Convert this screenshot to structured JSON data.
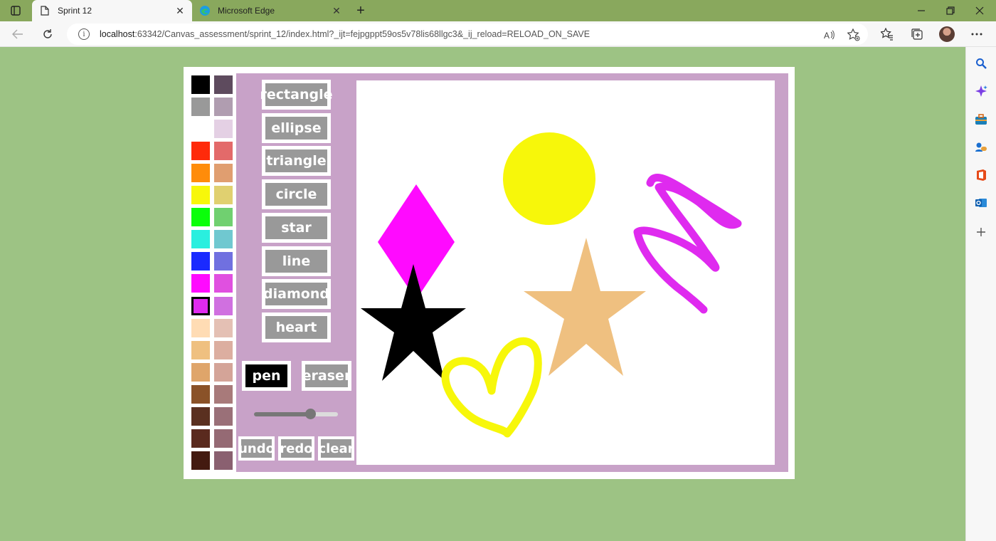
{
  "browser": {
    "tabs": [
      {
        "title": "Sprint 12",
        "close": "✕"
      },
      {
        "title": "Microsoft Edge",
        "close": "✕"
      }
    ],
    "new_tab": "+",
    "url_host": "localhost",
    "url_rest": ":63342/Canvas_assessment/sprint_12/index.html?_ijt=fejpgppt59os5v78lis68llgc3&_ij_reload=RELOAD_ON_SAVE"
  },
  "palette": {
    "colors": [
      [
        "#000000",
        "#5e4b5e"
      ],
      [
        "#999999",
        "#b09db0"
      ],
      [
        "#ffffff",
        "#e4d0e4"
      ],
      [
        "#ff2a0a",
        "#e36a6a"
      ],
      [
        "#ff8c0a",
        "#e09e70"
      ],
      [
        "#f7f70a",
        "#e0d070"
      ],
      [
        "#0aff0a",
        "#70d070"
      ],
      [
        "#2aefdf",
        "#70c8d0"
      ],
      [
        "#1a2aff",
        "#7070e0"
      ],
      [
        "#ff0aff",
        "#e050e0"
      ],
      [
        "#df2aef",
        "#d070e0"
      ],
      [
        "#ffdcb4",
        "#e4c0b4"
      ],
      [
        "#efc080",
        "#dcaea0"
      ],
      [
        "#dfa56a",
        "#d4a498"
      ],
      [
        "#8a5228",
        "#a87a7a"
      ],
      [
        "#5a3020",
        "#9a7078"
      ],
      [
        "#5a2a1e",
        "#956a74"
      ],
      [
        "#431a10",
        "#8a6070"
      ]
    ],
    "selected": "#df2aef"
  },
  "tools": {
    "shapes": [
      "rectangle",
      "ellipse",
      "triangle",
      "circle",
      "star",
      "line",
      "diamond",
      "heart"
    ],
    "pen": "pen",
    "eraser": "eraser",
    "undo": "undo",
    "redo": "redo",
    "clear": "clear",
    "brush_size": 0.67
  },
  "canvas": {
    "colors": {
      "circle": "#f7f70a",
      "diamond": "#ff0aff",
      "black_star": "#000000",
      "tan_star": "#efc080",
      "heart_stroke": "#f7f70a",
      "squiggle_stroke": "#df2aef"
    }
  }
}
